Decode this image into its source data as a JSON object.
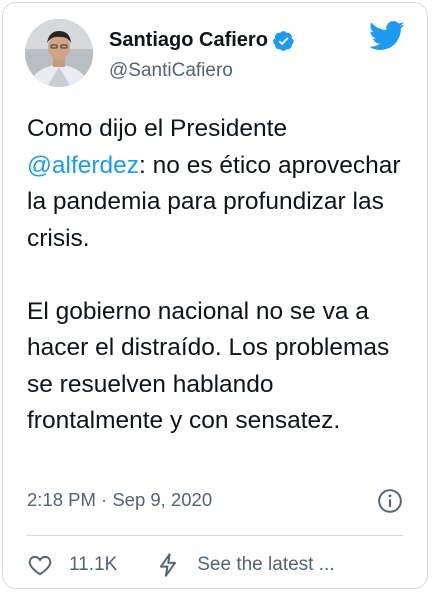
{
  "author": {
    "name": "Santiago Cafiero",
    "handle": "@SantiCafiero"
  },
  "tweet": {
    "line1_pre": "Como dijo el Presidente",
    "mention": "@alferdez",
    "line1_post": ": no es ético aprovechar la pandemia para profundizar las crisis.",
    "paragraph2": "El gobierno nacional no se va a hacer el distraído. Los problemas se resuelven hablando frontalmente y con sensatez."
  },
  "meta": {
    "timestamp": "2:18 PM · Sep 9, 2020"
  },
  "actions": {
    "likes": "11.1K",
    "see_latest": "See the latest ..."
  },
  "colors": {
    "accent": "#1d9bf0",
    "text": "#0f1419",
    "muted": "#536471",
    "border": "#cfd9de"
  }
}
